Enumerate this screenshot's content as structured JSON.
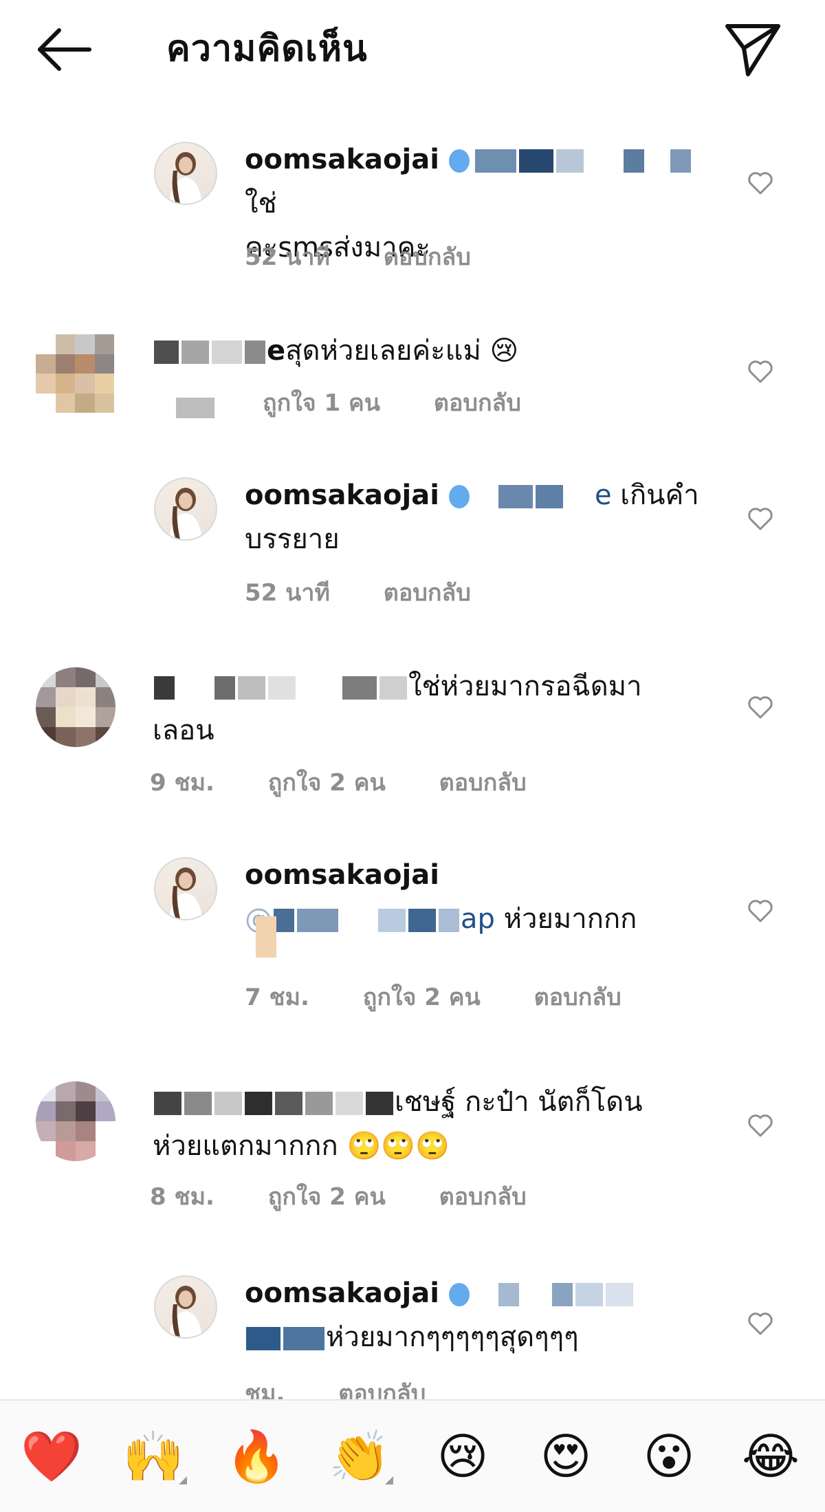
{
  "header": {
    "title": "ความคิดเห็น",
    "back_icon": "arrow-left-icon",
    "send_icon": "paper-plane-icon"
  },
  "comments": [
    {
      "type": "reply",
      "username": "oomsakaojai",
      "text_line1": "ใช่",
      "text_line2": "คะsmsส่งมาคะ",
      "time": "52 นาที",
      "likes": "",
      "reply_label": "ตอบกลับ"
    },
    {
      "type": "top",
      "username_suffix": "e",
      "text_line1": "สุดห่วยเลยค่ะแม่ 😢",
      "time": "",
      "likes": "ถูกใจ 1 คน",
      "reply_label": "ตอบกลับ"
    },
    {
      "type": "reply",
      "username": "oomsakaojai",
      "mention_suffix": "e",
      "text_line1": "เกินคำ",
      "text_line2": "บรรยาย",
      "time": "52 นาที",
      "likes": "",
      "reply_label": "ตอบกลับ"
    },
    {
      "type": "top",
      "text_line1": "ใช่ห่วยมากรอฉีดมา",
      "text_line2": "เลอน",
      "time": "9 ชม.",
      "likes": "ถูกใจ 2 คน",
      "reply_label": "ตอบกลับ"
    },
    {
      "type": "reply",
      "username": "oomsakaojai",
      "mention_prefix": "@",
      "mention_suffix": "ap",
      "text_line2": "ห่วยมากกก",
      "time": "7 ชม.",
      "likes": "ถูกใจ 2 คน",
      "reply_label": "ตอบกลับ"
    },
    {
      "type": "top",
      "text_line1": "เชษฐ์ กะป๋า นัตก็โดน",
      "text_line2": "ห่วยแตกมากกก 🙄🙄🙄",
      "time": "8 ชม.",
      "likes": "ถูกใจ 2 คน",
      "reply_label": "ตอบกลับ"
    },
    {
      "type": "reply",
      "username": "oomsakaojai",
      "text_line2": "ห่วยมากๆๆๆๆๆสุดๆๆๆ",
      "time": "ชม.",
      "likes": "",
      "reply_label": "ตอบกลับ"
    }
  ],
  "reactions": [
    "❤️",
    "🙌",
    "🔥",
    "👏",
    "😢",
    "😍",
    "😮",
    "😂"
  ],
  "colors": {
    "meta_text": "#8e8e8e",
    "verified": "#2f8ee8"
  }
}
